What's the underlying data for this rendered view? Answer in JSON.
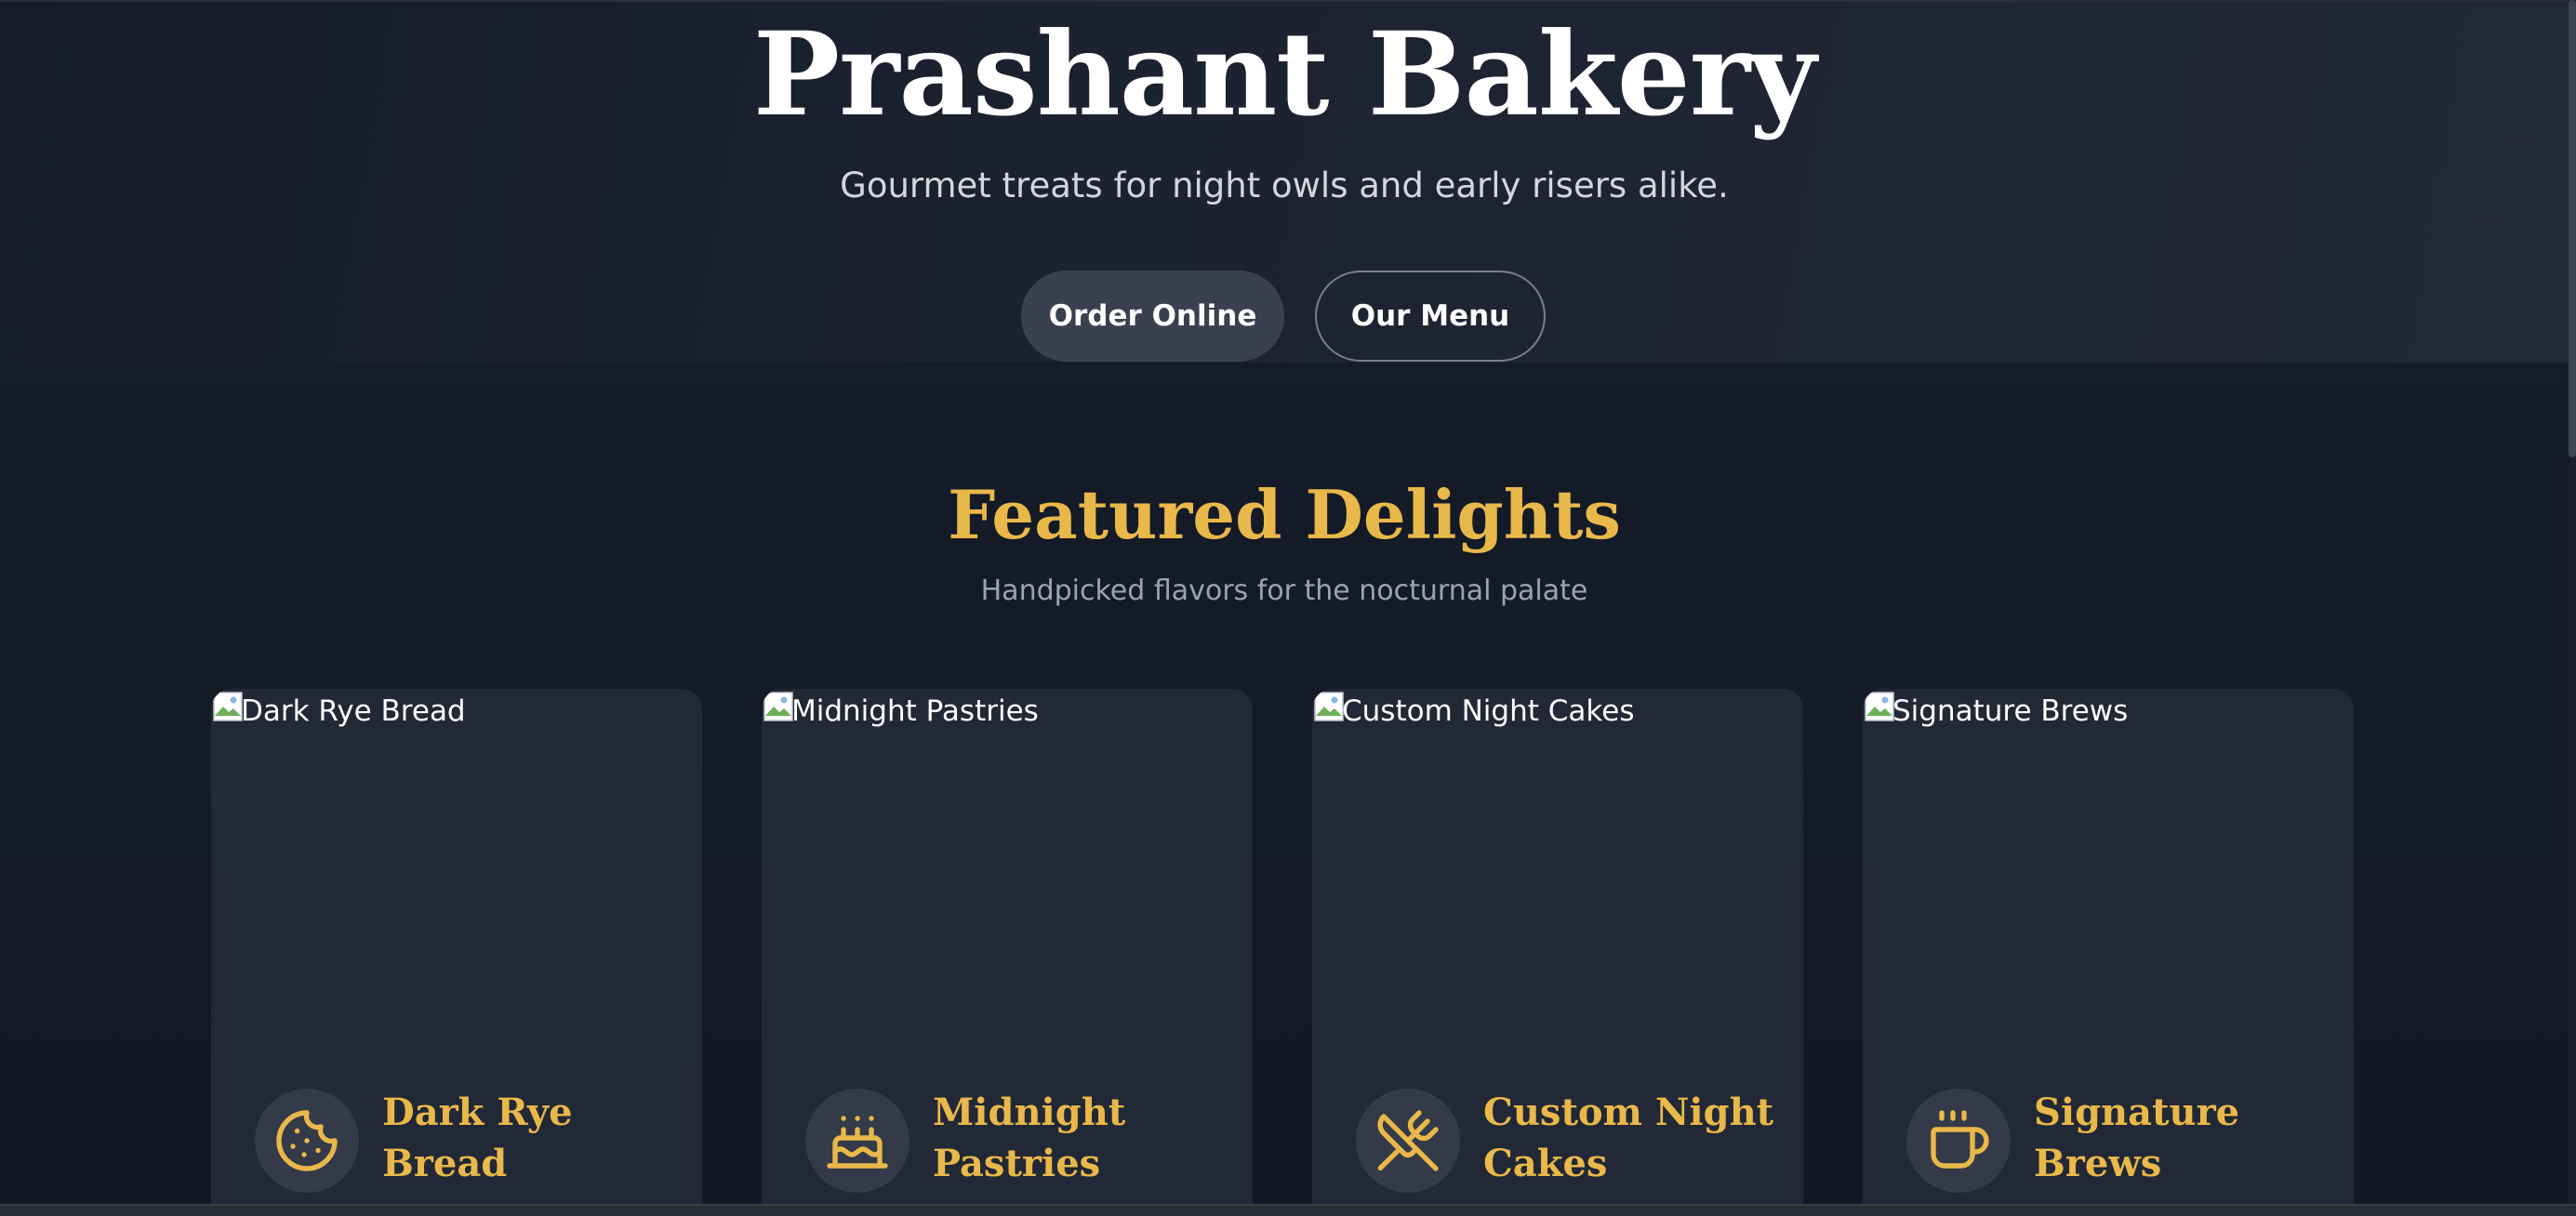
{
  "hero": {
    "title": "Prashant Bakery",
    "tagline": "Gourmet treats for night owls and early risers alike.",
    "order_button_label": "Order Online",
    "menu_button_label": "Our Menu"
  },
  "featured": {
    "title": "Featured Delights",
    "subtitle": "Handpicked flavors for the nocturnal palate",
    "cards": [
      {
        "image_alt": "Dark Rye Bread",
        "name": "Dark Rye Bread",
        "icon": "cookie-icon"
      },
      {
        "image_alt": "Midnight Pastries",
        "name": "Midnight Pastries",
        "icon": "cake-icon"
      },
      {
        "image_alt": "Custom Night Cakes",
        "name": "Custom Night Cakes",
        "icon": "utensils-crossed-icon"
      },
      {
        "image_alt": "Signature Brews",
        "name": "Signature Brews",
        "icon": "coffee-icon"
      }
    ]
  },
  "colors": {
    "accent": "#e8b84a",
    "background": "#141925",
    "card": "#222835",
    "button_primary": "#3a4050"
  }
}
